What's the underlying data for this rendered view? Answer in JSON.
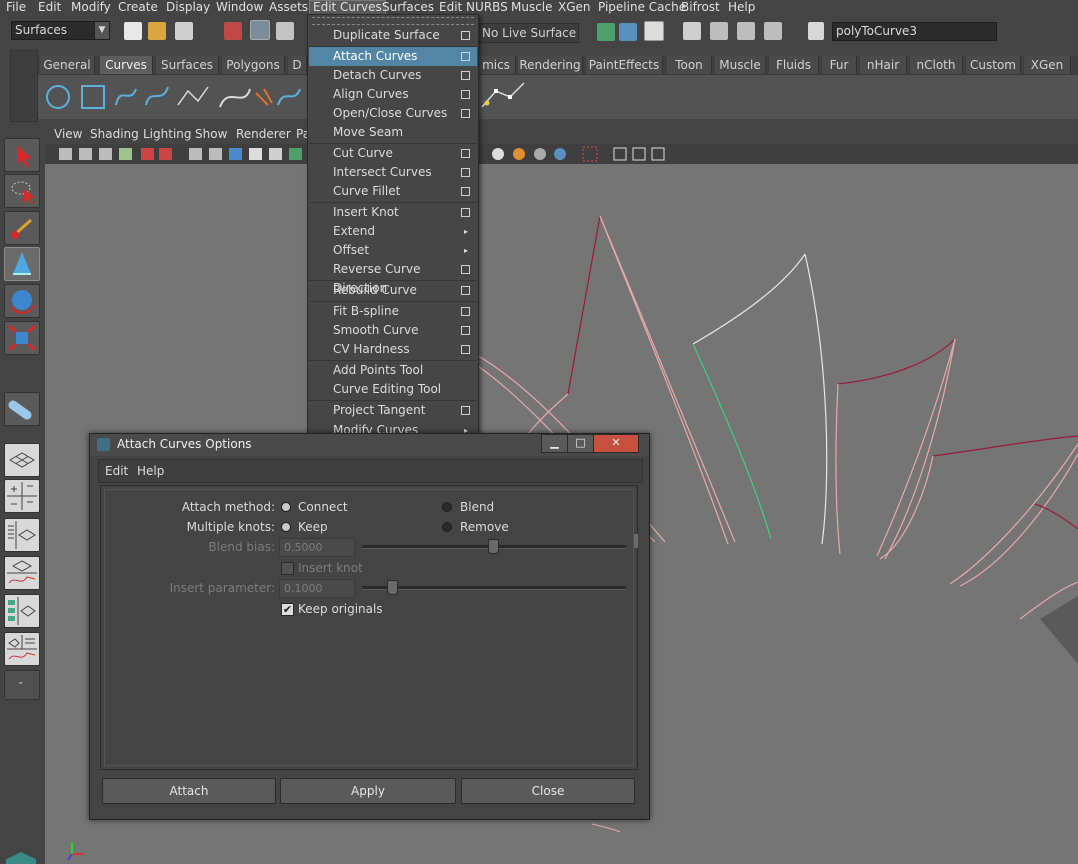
{
  "menubar": [
    {
      "label": "File"
    },
    {
      "label": "Edit"
    },
    {
      "label": "Modify"
    },
    {
      "label": "Create"
    },
    {
      "label": "Display"
    },
    {
      "label": "Window"
    },
    {
      "label": "Assets"
    },
    {
      "label": "Edit Curves"
    },
    {
      "label": "Surfaces"
    },
    {
      "label": "Edit NURBS"
    },
    {
      "label": "Muscle"
    },
    {
      "label": "XGen"
    },
    {
      "label": "Pipeline Cache"
    },
    {
      "label": "Bifrost"
    },
    {
      "label": "Help"
    }
  ],
  "status_line": {
    "mode_value": "Surfaces",
    "live_surface": "No Live Surface",
    "object_name": "polyToCurve3"
  },
  "shelf_tabs": [
    {
      "label": "General"
    },
    {
      "label": "Curves"
    },
    {
      "label": "Surfaces"
    },
    {
      "label": "Polygons"
    },
    {
      "label": "D"
    },
    {
      "label": "mics"
    },
    {
      "label": "Rendering"
    },
    {
      "label": "PaintEffects"
    },
    {
      "label": "Toon"
    },
    {
      "label": "Muscle"
    },
    {
      "label": "Fluids"
    },
    {
      "label": "Fur"
    },
    {
      "label": "nHair"
    },
    {
      "label": "nCloth"
    },
    {
      "label": "Custom"
    },
    {
      "label": "XGen"
    }
  ],
  "panel_menu": [
    {
      "label": "View"
    },
    {
      "label": "Shading"
    },
    {
      "label": "Lighting"
    },
    {
      "label": "Show"
    },
    {
      "label": "Renderer"
    },
    {
      "label": "Pa"
    }
  ],
  "edit_curves_menu": [
    {
      "label": "Duplicate Surface Curves",
      "kind": "option"
    },
    {
      "label": "Attach Curves",
      "kind": "option"
    },
    {
      "label": "Detach Curves",
      "kind": "option"
    },
    {
      "label": "Align Curves",
      "kind": "option"
    },
    {
      "label": "Open/Close Curves",
      "kind": "option"
    },
    {
      "label": "Move Seam",
      "kind": "plain"
    },
    {
      "label": "Cut Curve",
      "kind": "option"
    },
    {
      "label": "Intersect Curves",
      "kind": "option"
    },
    {
      "label": "Curve Fillet",
      "kind": "option"
    },
    {
      "label": "Insert Knot",
      "kind": "option"
    },
    {
      "label": "Extend",
      "kind": "submenu"
    },
    {
      "label": "Offset",
      "kind": "submenu"
    },
    {
      "label": "Reverse Curve Direction",
      "kind": "option"
    },
    {
      "label": "Rebuild Curve",
      "kind": "option"
    },
    {
      "label": "Fit B-spline",
      "kind": "option"
    },
    {
      "label": "Smooth Curve",
      "kind": "option"
    },
    {
      "label": "CV Hardness",
      "kind": "option"
    },
    {
      "label": "Add Points Tool",
      "kind": "plain"
    },
    {
      "label": "Curve Editing Tool",
      "kind": "plain"
    },
    {
      "label": "Project Tangent",
      "kind": "option"
    },
    {
      "label": "Modify Curves",
      "kind": "submenu"
    }
  ],
  "dialog": {
    "title": "Attach Curves Options",
    "menu": [
      "Edit",
      "Help"
    ],
    "attach_method_label": "Attach method:",
    "attach_method_options": [
      "Connect",
      "Blend"
    ],
    "multiple_knots_label": "Multiple knots:",
    "multiple_knots_options": [
      "Keep",
      "Remove"
    ],
    "blend_bias_label": "Blend bias:",
    "blend_bias_value": "0.5000",
    "insert_knot_label": "Insert knot",
    "insert_parameter_label": "Insert parameter:",
    "insert_parameter_value": "0.1000",
    "keep_originals_label": "Keep originals",
    "buttons": {
      "attach": "Attach",
      "apply": "Apply",
      "close": "Close"
    }
  },
  "colors": {
    "menu_highlight": "#5285a6",
    "viewport_bg": "#757575",
    "curve_dark": "#9b1a3a",
    "curve_light": "#e8a9a9",
    "curve_white": "#e6e6e6",
    "curve_green": "#3fd07f"
  }
}
